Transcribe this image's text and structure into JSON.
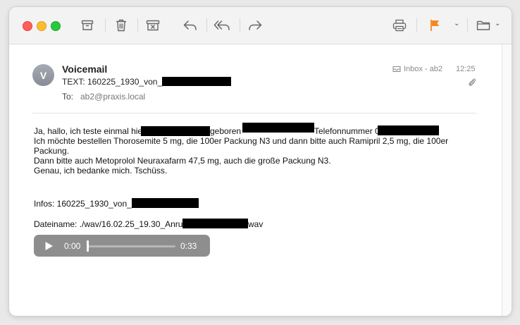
{
  "toolbar": {
    "icons": [
      "archive-icon",
      "trash-icon",
      "junk-icon",
      "reply-icon",
      "reply-all-icon",
      "forward-icon",
      "print-icon",
      "flag-icon",
      "folder-icon"
    ],
    "flag_color": "#f5891f"
  },
  "message": {
    "avatar_initial": "V",
    "sender": "Voicemail",
    "subject": "TEXT: 160225_1930_von_",
    "to_label": "To:",
    "to_value": "ab2@praxis.local",
    "mailbox": "Inbox - ab2",
    "time": "12:25"
  },
  "body": {
    "line1_a": "Ja, hallo, ich teste einmal hie",
    "line1_b": "geboren",
    "line1_c": "Telefonnummer 0",
    "line2": "Ich möchte bestellen Thorosemite 5 mg, die 100er Packung N3 und dann bitte auch Ramipril 2,5 mg, die 100er",
    "line3": "Packung.",
    "line4": "Dann bitte auch Metoprolol Neuraxafarm 47,5 mg, auch die große Packung N3.",
    "line5": "Genau, ich bedanke mich. Tschüss.",
    "infos": "Infos: 160225_1930_von_",
    "dateiname_a": "Dateiname: ./wav/16.02.25_19.30_Anru",
    "dateiname_b": "wav"
  },
  "audio": {
    "current": "0:00",
    "duration": "0:33",
    "progress": 0
  }
}
